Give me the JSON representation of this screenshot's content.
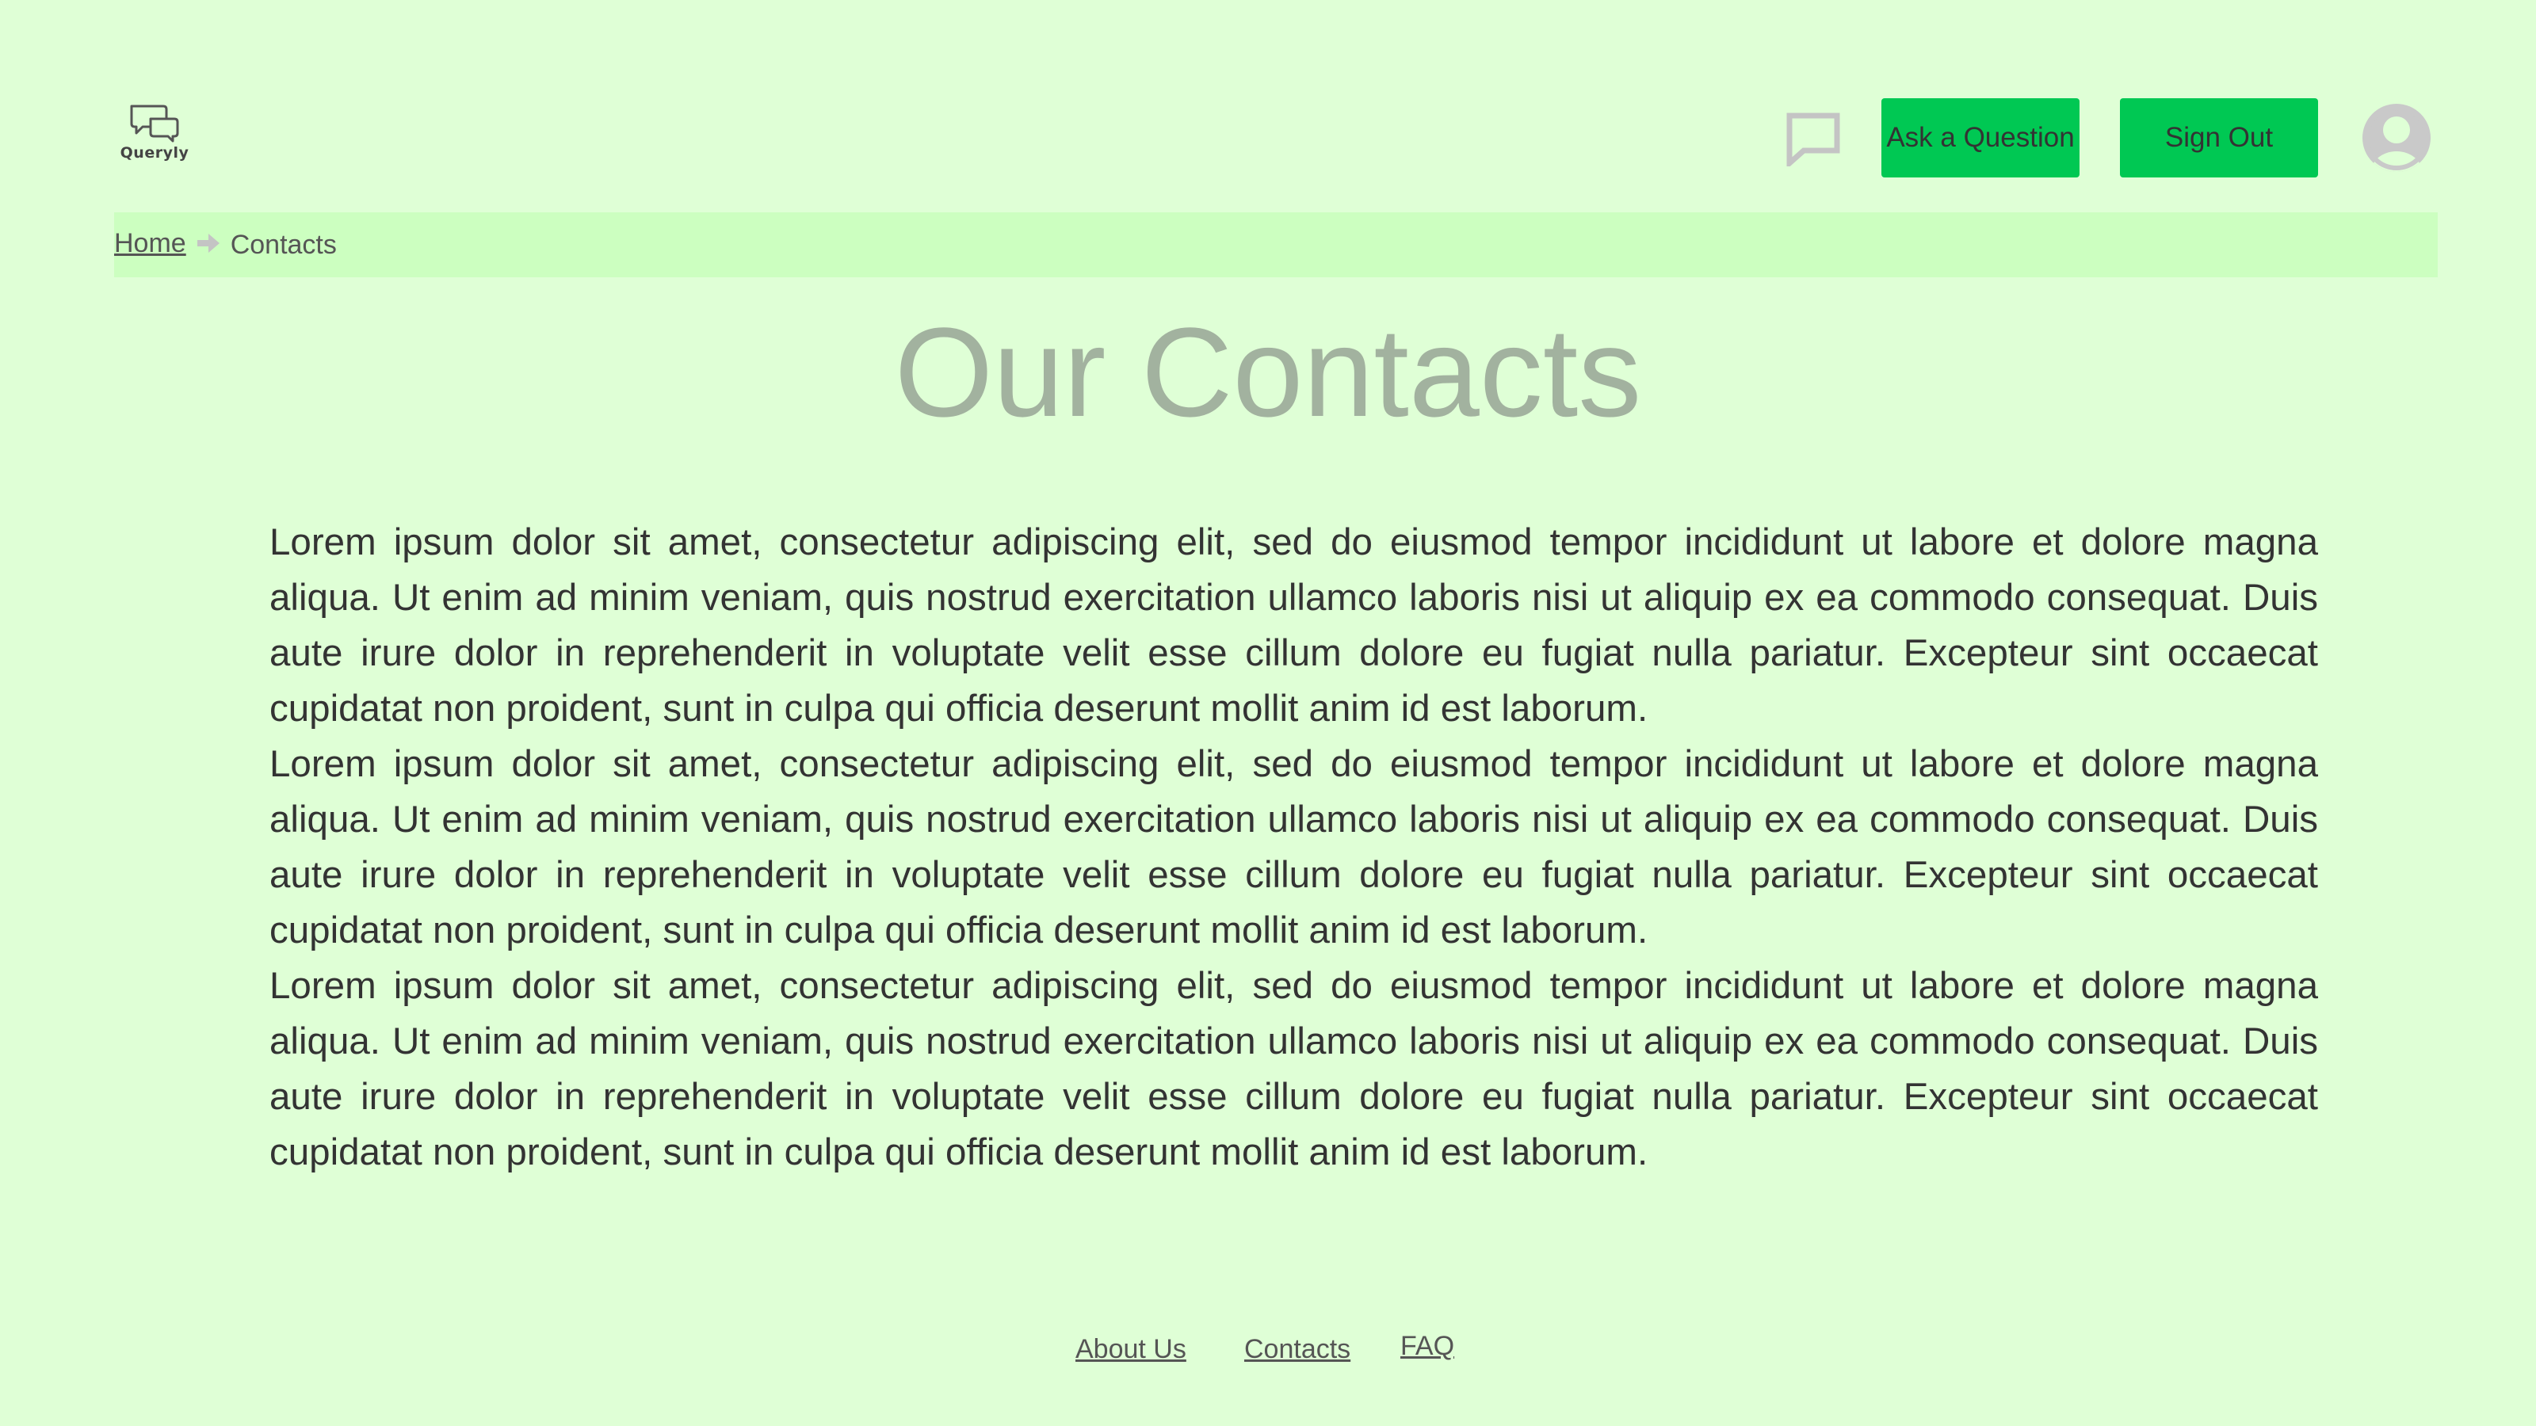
{
  "header": {
    "logo_text": "Queryly",
    "ask_button": "Ask a Question",
    "signout_button": "Sign Out"
  },
  "breadcrumb": {
    "home": "Home",
    "current": "Contacts"
  },
  "main": {
    "title": "Our Contacts",
    "paragraphs": [
      "Lorem ipsum dolor sit amet, consectetur adipiscing elit, sed do eiusmod tempor incididunt ut labore et dolore magna aliqua. Ut enim ad minim veniam, quis nostrud exercitation ullamco laboris nisi ut aliquip ex ea commodo consequat. Duis aute irure dolor in reprehenderit in voluptate velit esse cillum dolore eu fugiat nulla pariatur. Excepteur sint occaecat cupidatat non proident, sunt in culpa qui officia deserunt mollit anim id est laborum.",
      "Lorem ipsum dolor sit amet, consectetur adipiscing elit, sed do eiusmod tempor incididunt ut labore et dolore magna aliqua. Ut enim ad minim veniam, quis nostrud exercitation ullamco laboris nisi ut aliquip ex ea commodo consequat. Duis aute irure dolor in reprehenderit in voluptate velit esse cillum dolore eu fugiat nulla pariatur. Excepteur sint occaecat cupidatat non proident, sunt in culpa qui officia deserunt mollit anim id est laborum.",
      "Lorem ipsum dolor sit amet, consectetur adipiscing elit, sed do eiusmod tempor incididunt ut labore et dolore magna aliqua. Ut enim ad minim veniam, quis nostrud exercitation ullamco laboris nisi ut aliquip ex ea commodo consequat. Duis aute irure dolor in reprehenderit in voluptate velit esse cillum dolore eu fugiat nulla pariatur. Excepteur sint occaecat cupidatat non proident, sunt in culpa qui officia deserunt mollit anim id est laborum."
    ]
  },
  "footer": {
    "about": "About Us",
    "contacts": "Contacts",
    "faq": "FAQ"
  },
  "colors": {
    "background": "#dfffd6",
    "breadcrumb_bg": "#ccffc0",
    "button": "#00c853",
    "title": "#a2b29f",
    "icon_gray": "#c9c9c9"
  },
  "icons": {
    "logo": "chat-bubbles-logo-icon",
    "messages": "chat-bubble-icon",
    "breadcrumb_separator": "arrow-right-icon",
    "profile": "user-circle-icon"
  }
}
